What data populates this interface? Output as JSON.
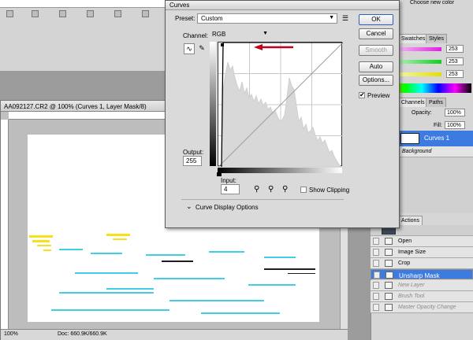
{
  "dialog": {
    "title": "Curves",
    "preset_label": "Preset:",
    "preset_value": "Custom",
    "channel_label": "Channel:",
    "channel_value": "RGB",
    "output_label": "Output:",
    "output_value": "255",
    "input_label": "Input:",
    "input_value": "4",
    "show_clipping": "Show Clipping",
    "display_options": "Curve Display Options",
    "buttons": {
      "ok": "OK",
      "cancel": "Cancel",
      "smooth": "Smooth",
      "auto": "Auto",
      "options": "Options..."
    },
    "preview_label": "Preview",
    "preview_checked": true,
    "accent": "#c0001a"
  },
  "document": {
    "title": "AA092127.CR2 @ 100% (Curves 1, Layer Mask/8)",
    "zoom": "100%",
    "doc_size": "Doc: 660.9K/660.9K"
  },
  "right_panel": {
    "tabs_top": [
      "Swatches",
      "Styles"
    ],
    "top_text": "Choose new color",
    "rgb_values": [
      "253",
      "253",
      "253"
    ],
    "tabs_layers": [
      "Channels",
      "Paths"
    ],
    "opacity_label": "Opacity:",
    "opacity_value": "100%",
    "fill_label": "Fill:",
    "fill_value": "100%",
    "layers": [
      {
        "name": "Curves 1",
        "selected": true
      },
      {
        "name": "Background",
        "selected": false
      }
    ],
    "actions_tab": "Actions",
    "history": [
      {
        "name": "Open",
        "state": "normal"
      },
      {
        "name": "Image Size",
        "state": "normal"
      },
      {
        "name": "Crop",
        "state": "normal"
      },
      {
        "name": "Unsharp Mask",
        "state": "selected"
      },
      {
        "name": "New Layer",
        "state": "dim"
      },
      {
        "name": "Brush Tool",
        "state": "dim"
      },
      {
        "name": "Master Opacity Change",
        "state": "dim"
      }
    ]
  }
}
